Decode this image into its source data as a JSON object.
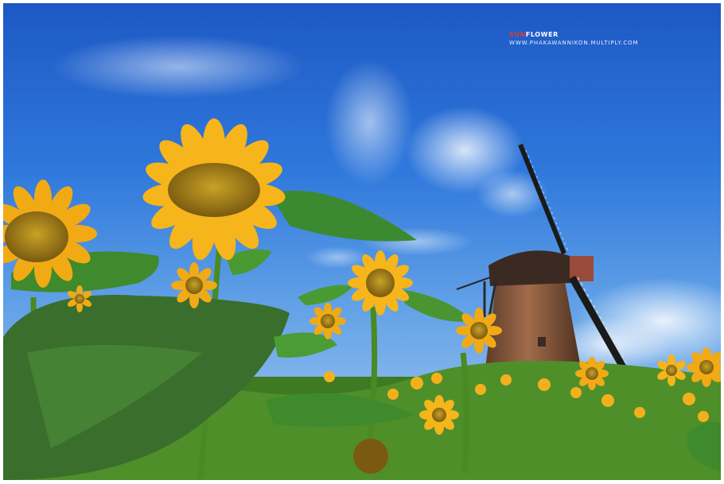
{
  "watermark": {
    "title_part1": "SUN",
    "title_part2": "FLOWER",
    "url": "WWW.PHAKAWANNIKON.MULTIPLY.COM"
  },
  "colors": {
    "sky_top": "#1d58c4",
    "sky_bottom": "#a9cdf0",
    "petal": "#f6b51a",
    "seed_center": "#8a6a12",
    "leaf": "#2f7d2a",
    "windmill_body": "#8a5a3c",
    "watermark_accent": "#e23b2c"
  }
}
